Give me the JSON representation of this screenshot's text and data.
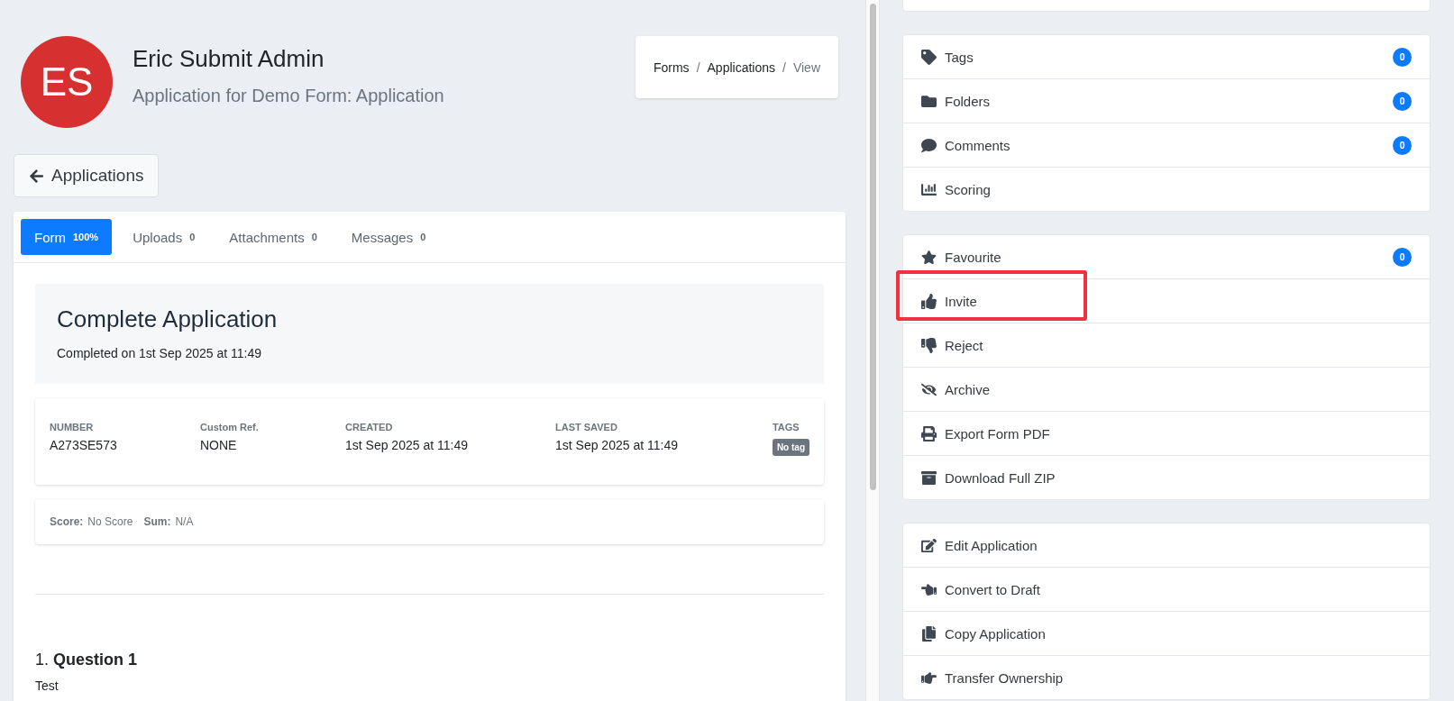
{
  "header": {
    "avatar_initials": "ES",
    "name": "Eric Submit Admin",
    "subtitle": "Application for Demo Form: Application"
  },
  "breadcrumb": [
    {
      "label": "Forms",
      "current": false
    },
    {
      "label": "Applications",
      "current": false
    },
    {
      "label": "View",
      "current": true
    }
  ],
  "breadcrumb_separator": "/",
  "back_button": "Applications",
  "tabs": [
    {
      "label": "Form",
      "count": "100%",
      "selected": true
    },
    {
      "label": "Uploads",
      "count": "0",
      "selected": false
    },
    {
      "label": "Attachments",
      "count": "0",
      "selected": false
    },
    {
      "label": "Messages",
      "count": "0",
      "selected": false
    }
  ],
  "status": {
    "title": "Complete Application",
    "subtitle": "Completed on 1st Sep 2025 at 11:49"
  },
  "details": [
    {
      "label": "NUMBER",
      "value": "A273SE573"
    },
    {
      "label": "Custom Ref.",
      "value": "NONE"
    },
    {
      "label": "CREATED",
      "value": "1st Sep 2025 at 11:49"
    },
    {
      "label": "LAST SAVED",
      "value": "1st Sep 2025 at 11:49"
    },
    {
      "label": "TAGS",
      "tag": "No tag"
    }
  ],
  "score": [
    {
      "label": "Score:",
      "value": "No Score"
    },
    {
      "label": "Sum:",
      "value": "N/A"
    }
  ],
  "question": {
    "title": "1. **Question 1**",
    "answer": "Test"
  },
  "action_groups": [
    [
      {
        "label": "Tags",
        "count": "0",
        "highlighted": false
      },
      {
        "label": "Folders",
        "count": "0",
        "highlighted": false
      },
      {
        "label": "Comments",
        "count": "0",
        "highlighted": false
      },
      {
        "label": "Scoring",
        "highlighted": false
      }
    ],
    [
      {
        "label": "Favourite",
        "count": "0",
        "highlighted": false
      },
      {
        "label": "Invite",
        "highlighted": true
      },
      {
        "label": "Reject",
        "highlighted": false
      },
      {
        "label": "Archive",
        "highlighted": false
      },
      {
        "label": "Export Form PDF",
        "highlighted": false
      },
      {
        "label": "Download Full ZIP",
        "highlighted": false
      }
    ],
    [
      {
        "label": "Edit Application",
        "highlighted": false
      },
      {
        "label": "Convert to Draft",
        "highlighted": false
      },
      {
        "label": "Copy Application",
        "highlighted": false
      },
      {
        "label": "Transfer Ownership",
        "highlighted": false
      }
    ]
  ]
}
